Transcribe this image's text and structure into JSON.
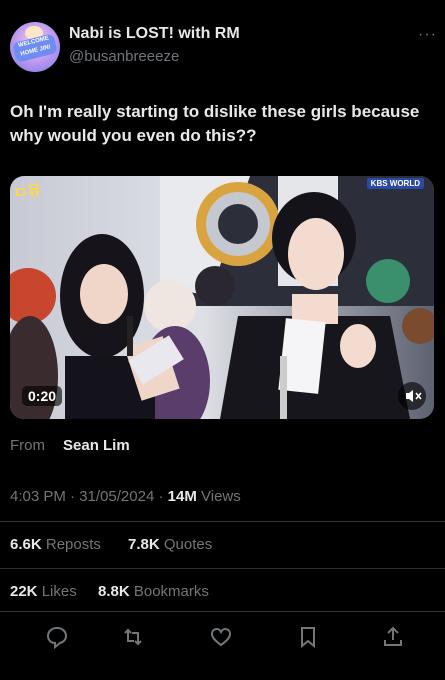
{
  "author": {
    "display_name": "Nabi is LOST! with RM",
    "handle": "@busanbreeeze",
    "avatar_text": "WELCOME HOME JIN!"
  },
  "tweet": {
    "text": "Oh I'm really starting to dislike these girls because why would you even do this??"
  },
  "media": {
    "duration": "0:20",
    "broadcaster": "KBS WORLD",
    "show_logo": "ㅁ뮤",
    "card_text": "뮤직"
  },
  "source": {
    "label": "From",
    "name": "Sean Lim"
  },
  "meta": {
    "time": "4:03 PM",
    "date": "31/05/2024",
    "views_count": "14M",
    "views_label": "Views",
    "separator": "·"
  },
  "stats_row1": {
    "reposts_count": "6.6K",
    "reposts_label": "Reposts",
    "quotes_count": "7.8K",
    "quotes_label": "Quotes"
  },
  "stats_row2": {
    "likes_count": "22K",
    "likes_label": "Likes",
    "bookmarks_count": "8.8K",
    "bookmarks_label": "Bookmarks"
  },
  "actions": [
    "reply-icon",
    "repost-icon",
    "like-icon",
    "bookmark-icon",
    "share-icon"
  ],
  "colors": {
    "background": "#000000",
    "text": "#e7e9ea",
    "muted": "#71767b",
    "divider": "#2f3336"
  }
}
